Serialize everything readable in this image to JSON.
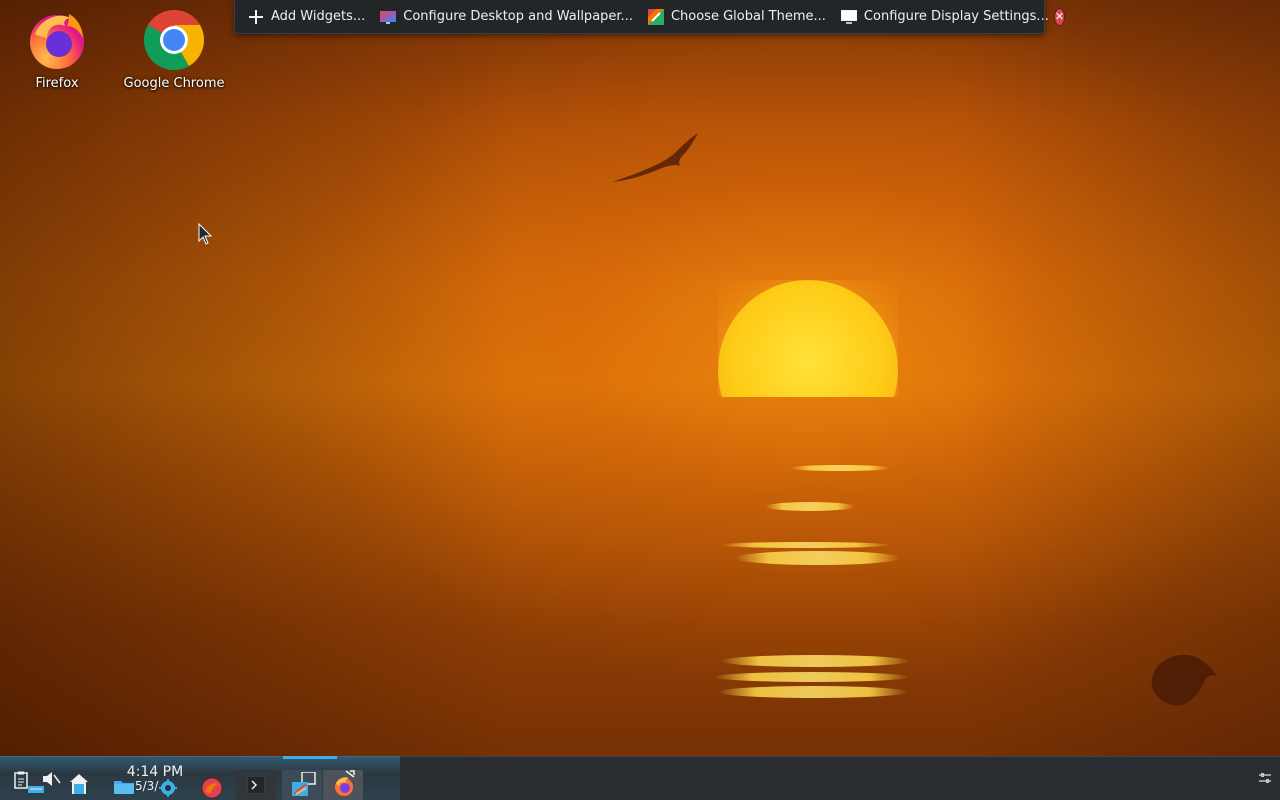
{
  "desktop": {
    "icons": [
      {
        "label": "Firefox",
        "icon": "firefox-icon"
      },
      {
        "label": "Google Chrome",
        "icon": "chrome-icon"
      }
    ]
  },
  "edit_toolbar": {
    "add_widgets": "Add Widgets...",
    "configure_desktop": "Configure Desktop and Wallpaper...",
    "global_theme": "Choose Global Theme...",
    "display_settings": "Configure Display Settings...",
    "close_icon": "close-icon"
  },
  "panel": {
    "clock": {
      "time": "4:14 PM",
      "date": "5/3/"
    },
    "icons": [
      "clipboard-icon",
      "network-icon",
      "volume-muted-icon",
      "home-folder-icon",
      "file-manager-icon",
      "settings-gear-icon",
      "app-launcher-icon",
      "terminal-icon",
      "desktop-edit-icon",
      "firefox-icon",
      "panel-config-icon"
    ]
  },
  "colors": {
    "accent": "#3daee9",
    "panel_bg": "#2a2e32",
    "toolbar_bg": "#232629",
    "close_red": "#da4453"
  }
}
